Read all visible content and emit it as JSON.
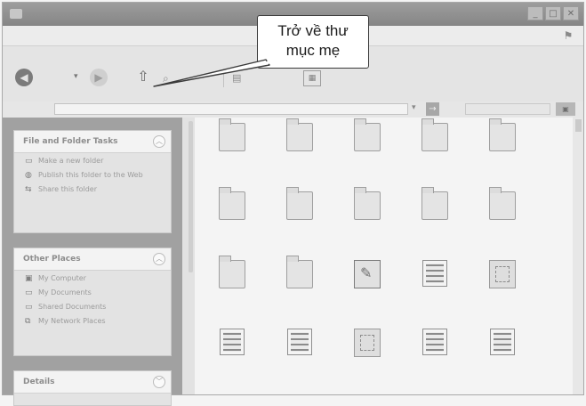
{
  "annotation": {
    "lines": [
      "Trở về thư",
      "mục mẹ"
    ]
  },
  "panels": [
    {
      "title": "File and Folder Tasks",
      "items": [
        {
          "icon": "new-folder-icon",
          "label": "Make a new folder"
        },
        {
          "icon": "globe-icon",
          "label": "Publish this folder to the Web"
        },
        {
          "icon": "share-icon",
          "label": "Share this folder"
        }
      ]
    },
    {
      "title": "Other Places",
      "items": [
        {
          "icon": "computer-icon",
          "label": "My Computer"
        },
        {
          "icon": "folder-icon",
          "label": "My Documents"
        },
        {
          "icon": "folder-icon",
          "label": "Shared Documents"
        },
        {
          "icon": "network-icon",
          "label": "My Network Places"
        }
      ]
    },
    {
      "title": "Details",
      "items": []
    }
  ]
}
